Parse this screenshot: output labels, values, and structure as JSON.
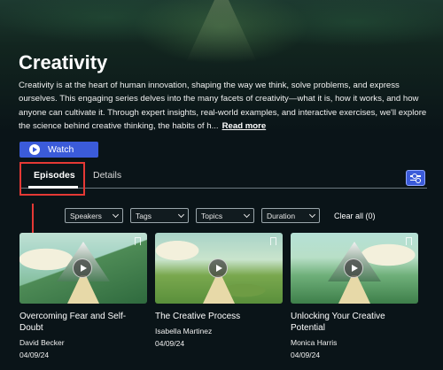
{
  "hero": {
    "title": "Creativity",
    "description": "Creativity is at the heart of human innovation, shaping the way we think, solve problems, and express ourselves. This engaging series delves into the many facets of creativity—what it is, how it works, and how anyone can cultivate it. Through expert insights, real-world examples, and interactive exercises, we'll explore the science behind creative thinking, the habits of h...",
    "read_more": "Read more",
    "watch_label": "Watch"
  },
  "tabs": {
    "episodes": "Episodes",
    "details": "Details",
    "active": "Episodes"
  },
  "filters": {
    "speakers": "Speakers",
    "tags": "Tags",
    "topics": "Topics",
    "duration": "Duration",
    "clear_all": "Clear all (0)"
  },
  "episodes": [
    {
      "title": "Overcoming Fear and Self-Doubt",
      "speaker": "David Becker",
      "date": "04/09/24"
    },
    {
      "title": "The Creative Process",
      "speaker": "Isabella Martinez",
      "date": "04/09/24"
    },
    {
      "title": "Unlocking Your Creative Potential",
      "speaker": "Monica Harris",
      "date": "04/09/24"
    }
  ],
  "annotations": {
    "highlight_color": "#e53935",
    "highlight_target": "tab-episodes"
  },
  "colors": {
    "accent": "#3b5bd9",
    "background": "#0a1418"
  },
  "icons": [
    "play-icon",
    "filter-settings-icon",
    "chevron-down-icon",
    "bookmark-icon",
    "arrow-down-icon"
  ]
}
